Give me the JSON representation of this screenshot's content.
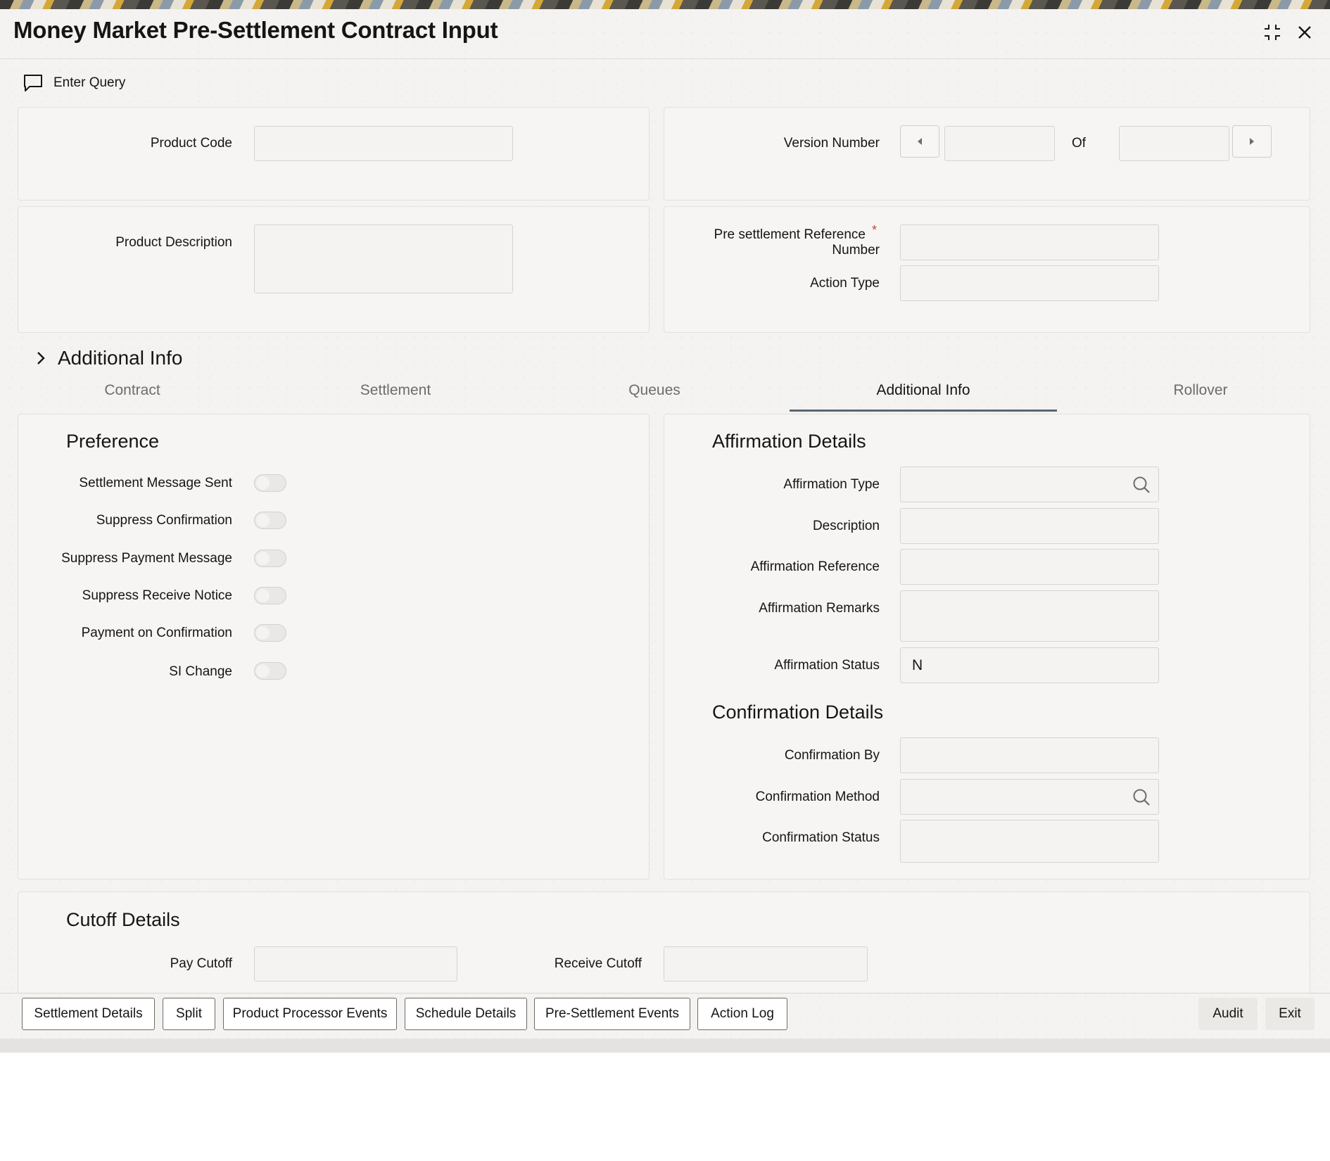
{
  "window": {
    "title": "Money Market Pre-Settlement Contract Input"
  },
  "toolbar": {
    "enter_query": "Enter Query"
  },
  "header": {
    "product_code_label": "Product Code",
    "product_code_value": "",
    "version_number_label": "Version Number",
    "version_number_value": "",
    "of_label": "Of",
    "of_value": "",
    "product_description_label": "Product Description",
    "product_description_value": "",
    "presettlement_ref_label_line1": "Pre settlement Reference",
    "presettlement_ref_label_line2": "Number",
    "required_mark": "*",
    "presettlement_ref_value": "",
    "action_type_label": "Action Type",
    "action_type_value": ""
  },
  "section": {
    "title": "Additional Info"
  },
  "tabs": [
    {
      "label": "Contract",
      "active": false
    },
    {
      "label": "Settlement",
      "active": false
    },
    {
      "label": "Queues",
      "active": false
    },
    {
      "label": "Additional Info",
      "active": true
    },
    {
      "label": "Rollover",
      "active": false
    }
  ],
  "preference": {
    "title": "Preference",
    "items": [
      {
        "label": "Settlement Message Sent",
        "checked": false
      },
      {
        "label": "Suppress Confirmation",
        "checked": false
      },
      {
        "label": "Suppress Payment Message",
        "checked": false
      },
      {
        "label": "Suppress Receive Notice",
        "checked": false
      },
      {
        "label": "Payment on Confirmation",
        "checked": false
      },
      {
        "label": "SI Change",
        "checked": false
      }
    ]
  },
  "affirmation": {
    "title": "Affirmation Details",
    "type_label": "Affirmation Type",
    "type_value": "",
    "description_label": "Description",
    "description_value": "",
    "reference_label": "Affirmation Reference",
    "reference_value": "",
    "remarks_label": "Affirmation Remarks",
    "remarks_value": "",
    "status_label": "Affirmation Status",
    "status_value": "N"
  },
  "confirmation": {
    "title": "Confirmation Details",
    "by_label": "Confirmation By",
    "by_value": "",
    "method_label": "Confirmation Method",
    "method_value": "",
    "status_label": "Confirmation Status",
    "status_value": ""
  },
  "cutoff": {
    "title": "Cutoff Details",
    "pay_label": "Pay Cutoff",
    "pay_value": "",
    "receive_label": "Receive Cutoff",
    "receive_value": ""
  },
  "footer": {
    "settlement_details": "Settlement Details",
    "split": "Split",
    "product_processor_events": "Product Processor Events",
    "schedule_details": "Schedule Details",
    "pre_settlement_events": "Pre-Settlement Events",
    "action_log": "Action Log",
    "audit": "Audit",
    "exit": "Exit"
  }
}
